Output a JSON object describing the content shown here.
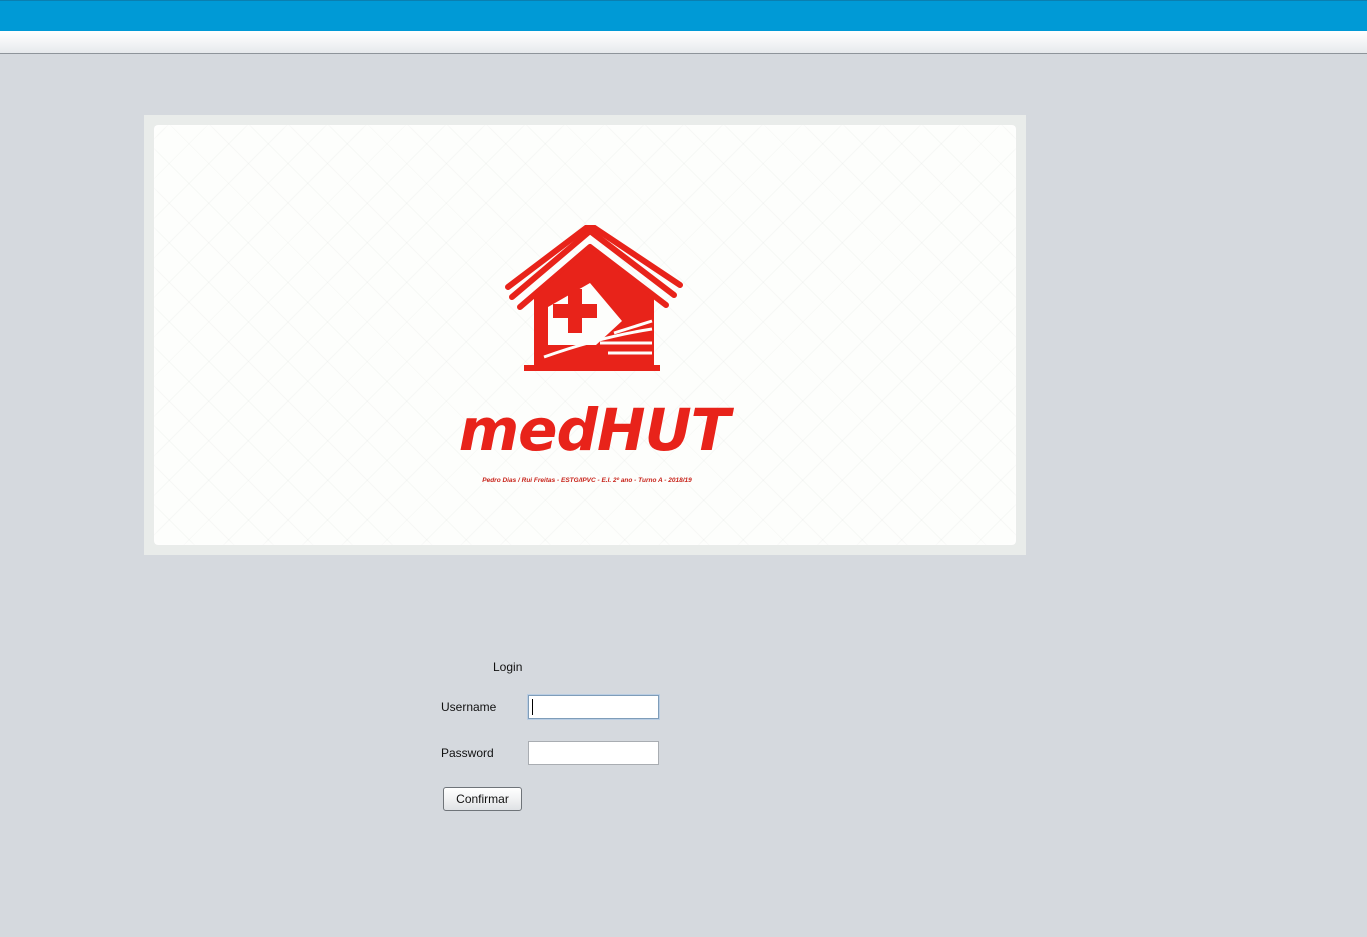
{
  "colors": {
    "top_bar": "#009ad6",
    "background": "#d5d9de",
    "brand_red": "#e8231a"
  },
  "banner": {
    "logo_icon": "house-with-red-cross-icon",
    "brand_name": "medHUT",
    "credits": "Pedro Dias / Rui Freitas - ESTG/IPVC - E.I. 2º ano - Turno A - 2018/19"
  },
  "login": {
    "title": "Login",
    "username_label": "Username",
    "username_value": "",
    "password_label": "Password",
    "password_value": "",
    "confirm_label": "Confirmar"
  }
}
